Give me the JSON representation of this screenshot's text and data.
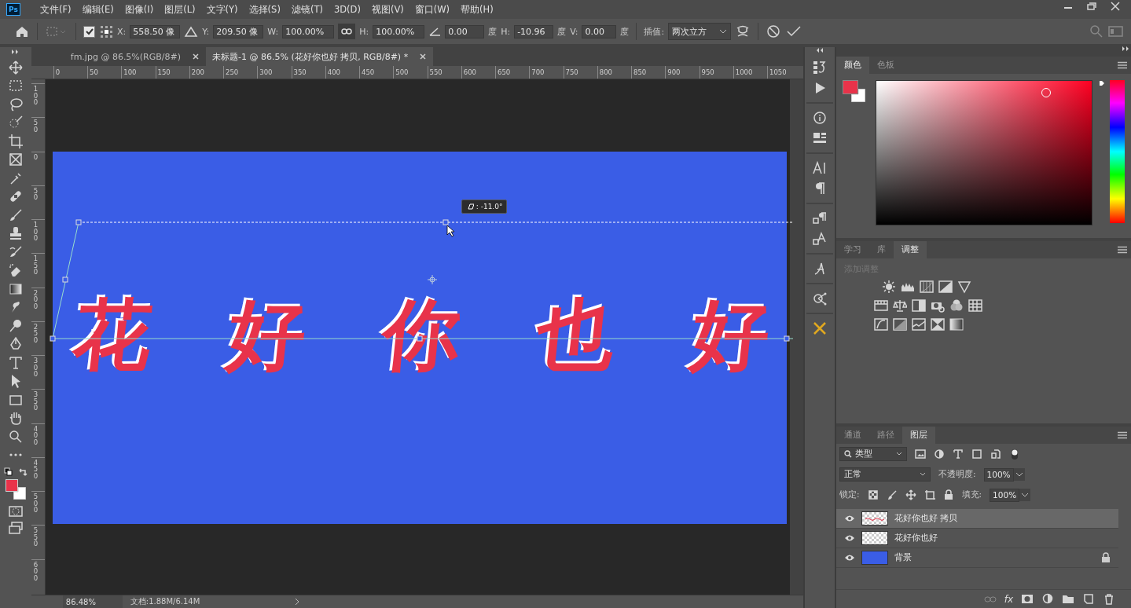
{
  "app": {
    "logo": "Ps"
  },
  "menu": [
    "文件(F)",
    "编辑(E)",
    "图像(I)",
    "图层(L)",
    "文字(Y)",
    "选择(S)",
    "滤镜(T)",
    "3D(D)",
    "视图(V)",
    "窗口(W)",
    "帮助(H)"
  ],
  "options_bar": {
    "reference_point_checked": true,
    "x": {
      "label": "X:",
      "value": "558.50 像"
    },
    "y": {
      "label": "Y:",
      "value": "209.50 像"
    },
    "w": {
      "label": "W:",
      "value": "100.00%"
    },
    "link_on": true,
    "h": {
      "label": "H:",
      "value": "100.00%"
    },
    "rotate": {
      "value": "0.00",
      "unit": "度"
    },
    "h_skew": {
      "label": "H:",
      "value": "-10.96",
      "unit": "度"
    },
    "v_skew": {
      "label": "V:",
      "value": "0.00",
      "unit": "度"
    },
    "interpolation": {
      "label": "插值:",
      "value": "两次立方"
    }
  },
  "tabs": [
    {
      "label": "fm.jpg @ 86.5%(RGB/8#)",
      "selected": false
    },
    {
      "label": "未标题-1 @ 86.5% (花好你也好 拷贝, RGB/8#) *",
      "selected": true
    }
  ],
  "rulers": {
    "horizontal": [
      "0",
      "50",
      "100",
      "150",
      "200",
      "250",
      "300",
      "350",
      "400",
      "450",
      "500",
      "550",
      "600",
      "650",
      "700",
      "750",
      "800",
      "850",
      "900",
      "950",
      "1000",
      "1050"
    ],
    "vertical": [
      "100",
      "50",
      "0",
      "50",
      "100",
      "150",
      "200",
      "250",
      "300",
      "350",
      "400",
      "450",
      "500",
      "550",
      "600"
    ]
  },
  "document": {
    "characters": [
      "花",
      "好",
      "你",
      "也",
      "好"
    ],
    "angle_readout": ": -11.0°"
  },
  "toolbar": {
    "swatches": [
      {
        "color": "#e8334a"
      },
      {
        "color": "#ffffff"
      }
    ]
  },
  "status_bar": {
    "zoom": "86.48%",
    "doc_info": "文档:1.88M/6.14M"
  },
  "color_panel": {
    "tabs": [
      {
        "label": "颜色",
        "selected": true
      },
      {
        "label": "色板",
        "selected": false
      }
    ],
    "swatches": [
      {
        "color": "#e8334a"
      },
      {
        "color": "#ffffff"
      }
    ],
    "hue": {
      "level": 1
    }
  },
  "adjustments_panel": {
    "tabs": [
      {
        "label": "学习",
        "selected": false
      },
      {
        "label": "库",
        "selected": false
      },
      {
        "label": "调整",
        "selected": true
      }
    ],
    "heading": "添加调整"
  },
  "layers_panel": {
    "tabs": [
      {
        "label": "通道",
        "selected": false
      },
      {
        "label": "路径",
        "selected": false
      },
      {
        "label": "图层",
        "selected": true
      }
    ],
    "filter": "类型",
    "blend_mode": "正常",
    "opacity_label": "不透明度:",
    "opacity": "100%",
    "lock_label": "锁定:",
    "fill_label": "填充:",
    "fill": "100%",
    "layers": [
      {
        "name": "花好你也好 拷贝",
        "selected": true,
        "visible": true,
        "kind": "text",
        "locked": false
      },
      {
        "name": "花好你也好",
        "selected": false,
        "visible": true,
        "kind": "pixel",
        "locked": false
      },
      {
        "name": "背景",
        "selected": false,
        "visible": true,
        "kind": "fill",
        "locked": true
      }
    ],
    "fx": "fx"
  }
}
